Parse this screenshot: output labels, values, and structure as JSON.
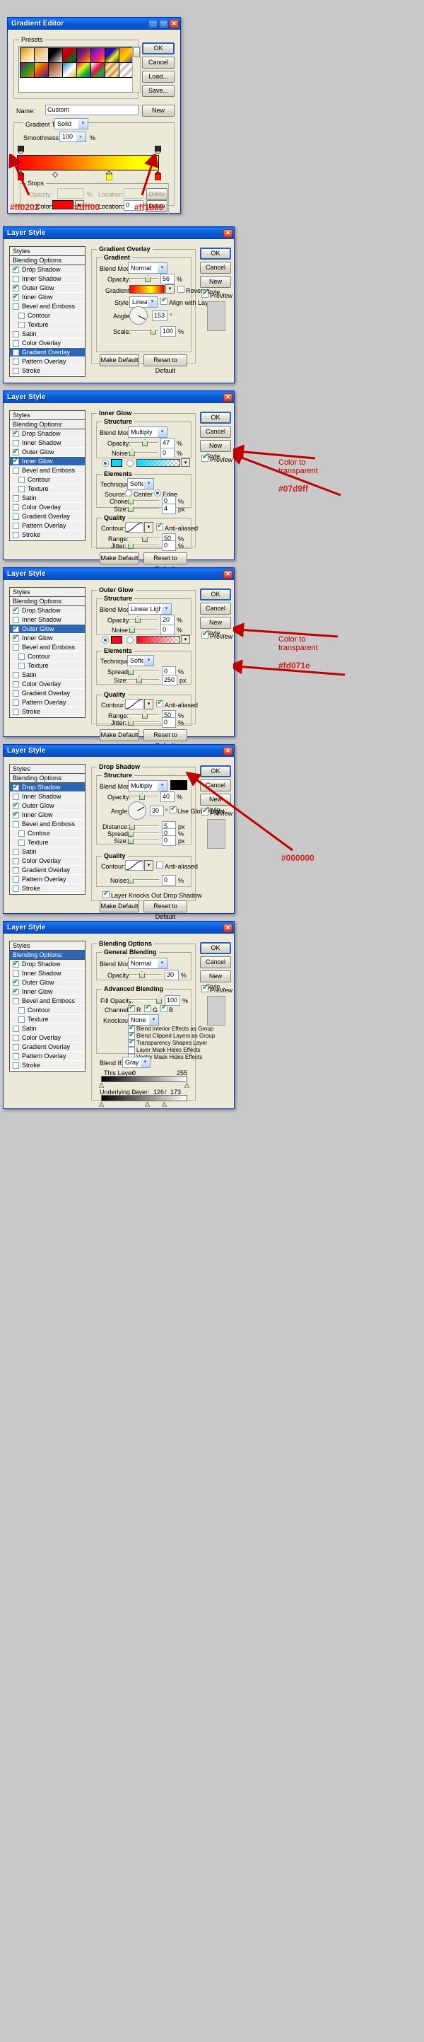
{
  "gradient_editor": {
    "title": "Gradient Editor",
    "window_buttons": [
      "_",
      "□",
      "✕"
    ],
    "presets_legend": "Presets",
    "buttons": {
      "ok": "OK",
      "cancel": "Cancel",
      "load": "Load...",
      "save": "Save...",
      "new": "New"
    },
    "name_label": "Name:",
    "name_value": "Custom",
    "gradient_type_legend": "",
    "gradient_type_label": "Gradient Type:",
    "gradient_type_value": "Solid",
    "smoothness_label": "Smoothness:",
    "smoothness_value": "100",
    "percent": "%",
    "stops_legend": "Stops",
    "opacity_label": "Opacity:",
    "opacity_value": "",
    "opacity_location_label": "Location:",
    "opacity_location_value": "",
    "delete_top_label": "Delete",
    "color_label": "Color:",
    "color_swatch": "#ff0202",
    "color_location_label": "Location:",
    "color_location_value": "0",
    "delete_label": "Delete",
    "degree": "°",
    "gradient_stops_hex": [
      "#ff0202",
      "#ffff00",
      "#ff1800"
    ],
    "gradient_css": "linear-gradient(90deg,#ff0202 0%,#ff3a00 22%,#ff8c00 45%,#ffd400 66%,#ffff00 84%,#ffff00 100%)",
    "preset_rows": [
      [
        "#d79a22",
        "#e8b04e",
        "#000000",
        "#d81414",
        "#3a1250",
        "#3820b0",
        "#2b1ea8",
        "#f07a10"
      ],
      [
        "#7a1070",
        "#f4d800",
        "#8a5a3a",
        "#1a7fd0",
        "#e0104a",
        "#ffffff",
        "#d8a038",
        "#c8c8c8"
      ]
    ]
  },
  "layer_style_common": {
    "title": "Layer Style",
    "close_glyph": "✕",
    "buttons": {
      "ok": "OK",
      "cancel": "Cancel",
      "new_style": "New Style...",
      "preview": "Preview"
    },
    "styles_header": "Styles",
    "blending_options": "Blending Options: Custom",
    "style_items": [
      {
        "label": "Drop Shadow",
        "checked": true,
        "indent": false
      },
      {
        "label": "Inner Shadow",
        "checked": false,
        "indent": false
      },
      {
        "label": "Outer Glow",
        "checked": true,
        "indent": false
      },
      {
        "label": "Inner Glow",
        "checked": true,
        "indent": false
      },
      {
        "label": "Bevel and Emboss",
        "checked": false,
        "indent": false
      },
      {
        "label": "Contour",
        "checked": false,
        "indent": true
      },
      {
        "label": "Texture",
        "checked": false,
        "indent": true
      },
      {
        "label": "Satin",
        "checked": false,
        "indent": false
      },
      {
        "label": "Color Overlay",
        "checked": false,
        "indent": false
      },
      {
        "label": "Gradient Overlay",
        "checked": false,
        "indent": false
      },
      {
        "label": "Pattern Overlay",
        "checked": false,
        "indent": false
      },
      {
        "label": "Stroke",
        "checked": false,
        "indent": false
      }
    ],
    "make_default": "Make Default",
    "reset_to_default": "Reset to Default",
    "percent": "%",
    "px": "px",
    "degree": "°"
  },
  "dialog_gradient_overlay": {
    "selected_style": "Gradient Overlay",
    "section_legend": "Gradient Overlay",
    "sub_legend": "Gradient",
    "blend_mode_label": "Blend Mode:",
    "blend_mode_value": "Normal",
    "opacity_label": "Opacity:",
    "opacity_value": "56",
    "gradient_label": "Gradient:",
    "reverse_label": "Reverse",
    "reverse_checked": false,
    "style_label": "Style:",
    "style_value": "Linear",
    "align_label": "Align with Layer",
    "align_checked": true,
    "angle_label": "Angle:",
    "angle_value": "153",
    "scale_label": "Scale:",
    "scale_value": "100",
    "gradient_css": "linear-gradient(90deg,#ff0202 0%,#ff5400 20%,#ffa000 40%,#ffff00 62%,#ff7b00 82%,#e60000 100%)"
  },
  "dialog_inner_glow": {
    "selected_style": "Inner Glow",
    "section_legend": "Inner Glow",
    "sub_legend": "Structure",
    "blend_mode_label": "Blend Mode:",
    "blend_mode_value": "Multiply",
    "opacity_label": "Opacity:",
    "opacity_value": "47",
    "noise_label": "Noise:",
    "noise_value": "0",
    "color_swatch": "#07d9ff",
    "gradient_css": "linear-gradient(90deg,#07d9ff 0%,rgba(7,217,255,0) 100%)",
    "elements_legend": "Elements",
    "technique_label": "Technique:",
    "technique_value": "Softer",
    "source_label": "Source:",
    "source_center": "Center",
    "source_edge": "Edge",
    "source_selected": "Edge",
    "choke_label": "Choke:",
    "choke_value": "0",
    "size_label": "Size:",
    "size_value": "4",
    "quality_legend": "Quality",
    "contour_label": "Contour:",
    "antialiased_label": "Anti-aliased",
    "antialiased_checked": true,
    "range_label": "Range:",
    "range_value": "50",
    "jitter_label": "Jitter:",
    "jitter_value": "0",
    "annotation": "Color to\ntransparent",
    "annotation_hex": "#07d9ff"
  },
  "dialog_outer_glow": {
    "selected_style": "Outer Glow",
    "section_legend": "Outer Glow",
    "sub_legend": "Structure",
    "blend_mode_label": "Blend Mode:",
    "blend_mode_value": "Linear Light",
    "opacity_label": "Opacity:",
    "opacity_value": "20",
    "noise_label": "Noise:",
    "noise_value": "0",
    "color_swatch": "#fd071e",
    "gradient_css": "linear-gradient(90deg,#fd071e 0%,rgba(253,7,30,0) 100%)",
    "elements_legend": "Elements",
    "technique_label": "Technique:",
    "technique_value": "Softer",
    "spread_label": "Spread:",
    "spread_value": "0",
    "size_label": "Size:",
    "size_value": "250",
    "quality_legend": "Quality",
    "contour_label": "Contour:",
    "antialiased_label": "Anti-aliased",
    "antialiased_checked": true,
    "range_label": "Range:",
    "range_value": "50",
    "jitter_label": "Jitter:",
    "jitter_value": "0",
    "annotation": "Color to\ntransparent",
    "annotation_hex": "#fd071e"
  },
  "dialog_drop_shadow": {
    "selected_style": "Drop Shadow",
    "section_legend": "Drop Shadow",
    "sub_legend": "Structure",
    "blend_mode_label": "Blend Mode:",
    "blend_mode_value": "Multiply",
    "opacity_label": "Opacity:",
    "opacity_value": "40",
    "color_swatch": "#000000",
    "angle_label": "Angle:",
    "angle_value": "30",
    "use_global_light": "Use Global Light",
    "use_global_checked": true,
    "distance_label": "Distance:",
    "distance_value": "5",
    "spread_label": "Spread:",
    "spread_value": "0",
    "size_label": "Size:",
    "size_value": "0",
    "quality_legend": "Quality",
    "contour_label": "Contour:",
    "antialiased_label": "Anti-aliased",
    "antialiased_checked": false,
    "noise_label": "Noise:",
    "noise_value": "0",
    "knockout_label": "Layer Knocks Out Drop Shadow",
    "knockout_checked": true,
    "annotation_hex": "#000000"
  },
  "dialog_blending_options": {
    "selected_style": "Blending Options: Custom",
    "section_legend": "Blending Options",
    "general_legend": "General Blending",
    "blend_mode_label": "Blend Mode:",
    "blend_mode_value": "Normal",
    "opacity_label": "Opacity:",
    "opacity_value": "30",
    "advanced_legend": "Advanced Blending",
    "fill_opacity_label": "Fill Opacity:",
    "fill_opacity_value": "100",
    "channels_label": "Channels:",
    "channel_r": "R",
    "channel_g": "G",
    "channel_b": "B",
    "knockout_label": "Knockout:",
    "knockout_value": "None",
    "checkboxes": [
      {
        "label": "Blend Interior Effects as Group",
        "checked": true
      },
      {
        "label": "Blend Clipped Layers as Group",
        "checked": true
      },
      {
        "label": "Transparency Shapes Layer",
        "checked": true
      },
      {
        "label": "Layer Mask Hides Effects",
        "checked": false
      },
      {
        "label": "Vector Mask Hides Effects",
        "checked": false
      }
    ],
    "blend_if_label": "Blend If:",
    "blend_if_value": "Gray",
    "this_layer_label": "This Layer:",
    "this_layer_min": "0",
    "this_layer_max": "255",
    "underlying_label": "Underlying Layer:",
    "underlying_min": "0",
    "underlying_mid": "126",
    "underlying_slash": "/",
    "underlying_max": "173"
  }
}
